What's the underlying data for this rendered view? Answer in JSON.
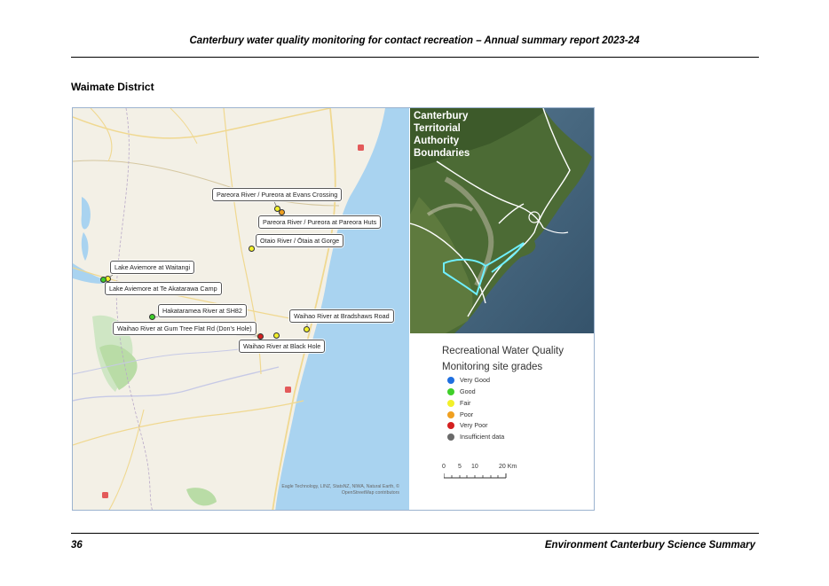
{
  "header": {
    "title": "Canterbury water quality monitoring for contact recreation – Annual summary report 2023-24"
  },
  "section": {
    "title": "Waimate District"
  },
  "map": {
    "sites": [
      {
        "label": "Pareora River / Pureora at Evans Crossing",
        "grade": "Fair"
      },
      {
        "label": "Pareora River / Pureora at Pareora Huts",
        "grade": "Poor"
      },
      {
        "label": "Otaio River / Ōtaia at Gorge",
        "grade": "Fair"
      },
      {
        "label": "Lake Aviemore at Waitangi",
        "grade": "Fair"
      },
      {
        "label": "Lake Aviemore at Te Akatarawa Camp",
        "grade": "Good"
      },
      {
        "label": "Hakataramea River at SH82",
        "grade": "Good"
      },
      {
        "label": "Waihao River at Bradshaws Road",
        "grade": "Fair"
      },
      {
        "label": "Waihao River at Gum Tree Flat Rd (Don's Hole)",
        "grade": "Very Poor"
      },
      {
        "label": "Waihao River at Black Hole",
        "grade": "Fair"
      }
    ],
    "credit": "Eagle Technology, LINZ, StatsNZ, NIWA, Natural Earth, © OpenStreetMap contributors"
  },
  "inset": {
    "title_lines": [
      "Canterbury",
      "Territorial",
      "Authority",
      "Boundaries"
    ]
  },
  "legend": {
    "title_lines": [
      "Recreational Water Quality",
      "Monitoring site grades"
    ],
    "items": [
      {
        "label": "Very Good",
        "color": "#1f6fe0"
      },
      {
        "label": "Good",
        "color": "#3fcf2a"
      },
      {
        "label": "Fair",
        "color": "#f2f02a"
      },
      {
        "label": "Poor",
        "color": "#f0a020"
      },
      {
        "label": "Very Poor",
        "color": "#d42020"
      },
      {
        "label": "Insufficient data",
        "color": "#6a6a6a"
      }
    ],
    "scale": {
      "ticks": [
        "0",
        "5",
        "10",
        "20 Km"
      ]
    }
  },
  "footer": {
    "page_number": "36",
    "publication": "Environment Canterbury Science Summary"
  }
}
